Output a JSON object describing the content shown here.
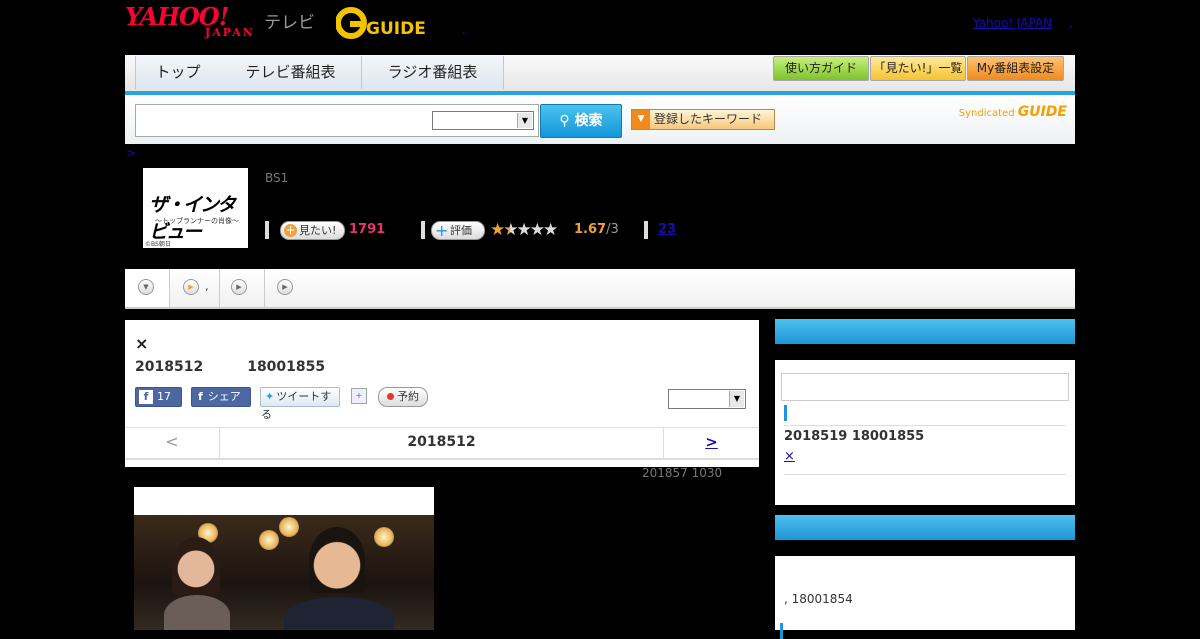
{
  "header": {
    "yahoo_logo": "YAHOO!",
    "japan_label": "JAPAN",
    "tv_label": "テレビ",
    "gguide_logo": "G-GUIDE",
    "top_comma": ",",
    "yahoo_japan_link": "Yahoo! JAPAN",
    "yahoo_japan_comma": ","
  },
  "nav": {
    "tabs": [
      {
        "label": "トップ"
      },
      {
        "label": "テレビ番組表"
      },
      {
        "label": "ラジオ番組表"
      }
    ],
    "buttons": [
      {
        "label": "使い方ガイド"
      },
      {
        "label": "「見たい!」一覧"
      },
      {
        "label": "My番組表設定"
      }
    ]
  },
  "search": {
    "query": "",
    "select_value": "",
    "search_button": "検索",
    "keyword_button": "登録したキーワード",
    "syndicated": "Syndicated",
    "syndicated_logo": "GUIDE"
  },
  "breadcrumb": ">",
  "program": {
    "thumb_title": "ザ・インタビュー",
    "thumb_subtitle": "〜トップランナーの肖像〜",
    "thumb_credit": "©BS朝日",
    "channel": "BS1",
    "mitai_label": "見たい!",
    "mitai_count": "1791",
    "hyoka_label": "評価",
    "rating": "1.67",
    "rating_max": "/3",
    "rating_value": 1.67,
    "review_count": "23"
  },
  "subtabs": [
    "",
    ",",
    "",
    ""
  ],
  "main": {
    "close_label": "×",
    "date": "2018512",
    "time": "18001855",
    "fb_like_count": "17",
    "fb_share": "シェア",
    "tweet": "ツイートする",
    "yoyaku": "予約",
    "select_value": "",
    "prev": "<",
    "day_label": "2018512",
    "next": ">",
    "updated": "201857  1030"
  },
  "sidebar": {
    "next_datetime": "2018519  18001855",
    "close_link": "×",
    "second_text": ", 18001854"
  },
  "colors": {
    "accent": "#1d96d6",
    "pink": "#e8336d",
    "orange": "#f0a23a",
    "yahoo_red": "#ff0033"
  }
}
